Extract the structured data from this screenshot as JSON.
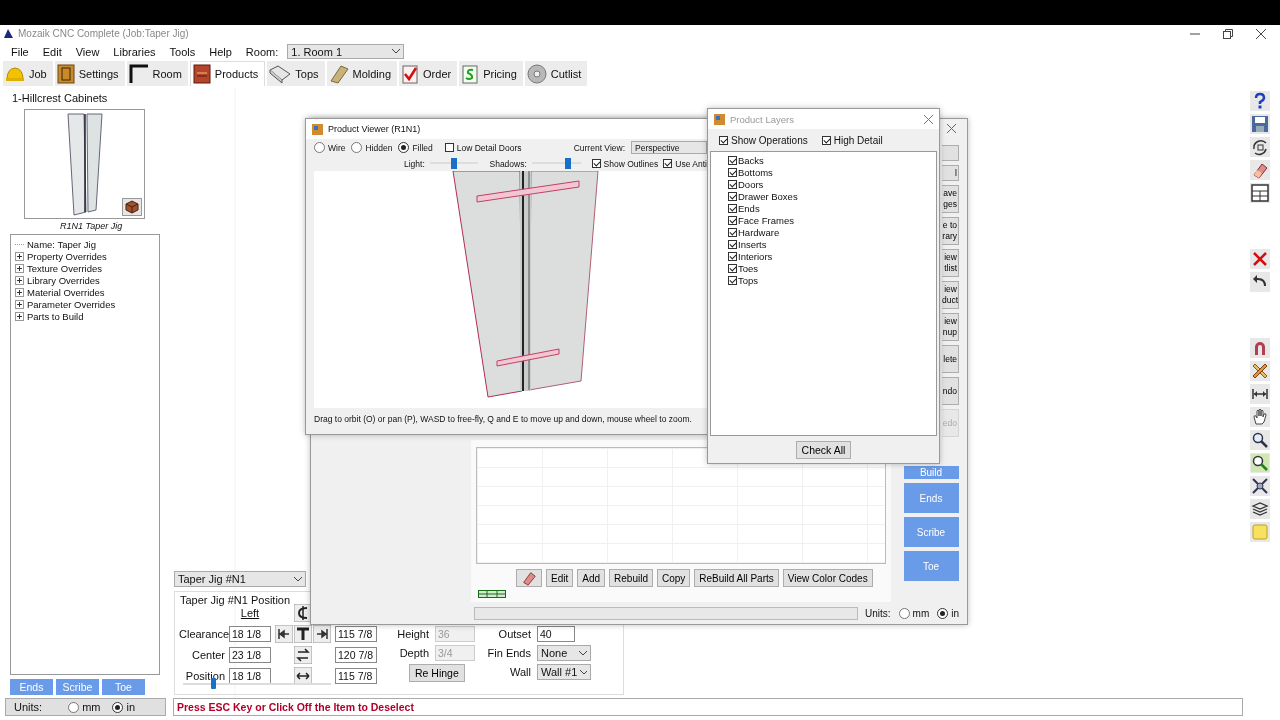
{
  "window": {
    "title": "Mozaik CNC Complete (Job:Taper Jig)"
  },
  "menu": [
    "File",
    "Edit",
    "View",
    "Libraries",
    "Tools",
    "Help"
  ],
  "room": {
    "label": "Room:",
    "value": "1. Room 1"
  },
  "tabs": [
    {
      "label": "Job",
      "selected": false
    },
    {
      "label": "Settings",
      "selected": false
    },
    {
      "label": "Room",
      "selected": false
    },
    {
      "label": "Products",
      "selected": true
    },
    {
      "label": "Tops",
      "selected": false
    },
    {
      "label": "Molding",
      "selected": false
    },
    {
      "label": "Order",
      "selected": false
    },
    {
      "label": "Pricing",
      "selected": false
    },
    {
      "label": "Cutlist",
      "selected": false
    }
  ],
  "left_panel": {
    "title": "1-Hillcrest Cabinets",
    "caption": "R1N1 Taper Jig",
    "tree": [
      {
        "label": "Name: Taper Jig"
      },
      {
        "label": "Property Overrides",
        "expanded": false
      },
      {
        "label": "Texture Overrides",
        "expanded": false
      },
      {
        "label": "Library Overrides",
        "expanded": false
      },
      {
        "label": "Material Overrides",
        "expanded": false
      },
      {
        "label": "Parameter Overrides",
        "expanded": false
      },
      {
        "label": "Parts to Build",
        "expanded": false
      }
    ],
    "buttons": [
      "Ends",
      "Scribe",
      "Toe"
    ],
    "units": {
      "label": "Units:",
      "options": [
        {
          "label": "mm",
          "selected": false
        },
        {
          "label": "in",
          "selected": true
        }
      ]
    }
  },
  "product_select": {
    "value": "Taper Jig #N1"
  },
  "position_panel": {
    "title": "Taper Jig #N1 Position",
    "column_header": "Left",
    "rows": [
      {
        "label": "Clearance",
        "left": "18 1/8",
        "right": "115 7/8"
      },
      {
        "label": "Center",
        "left": "23 1/8",
        "right": "120 7/8"
      },
      {
        "label": "Position",
        "left": "18 1/8",
        "right": "115 7/8"
      }
    ],
    "slider": {
      "level": 0.2
    },
    "middle": [
      {
        "label": "Height",
        "value": "36",
        "disabled": true
      },
      {
        "label": "Depth",
        "value": "3/4",
        "disabled": true
      }
    ],
    "rehinge": "Re Hinge",
    "right": [
      {
        "label": "Outset",
        "value": "40",
        "kind": "input"
      },
      {
        "label": "Fin Ends",
        "value": "None",
        "kind": "select"
      },
      {
        "label": "Wall",
        "value": "Wall #1",
        "kind": "select"
      }
    ]
  },
  "status_message": "Press ESC Key or Click Off the Item to Deselect",
  "editor_dialog": {
    "side_buttons": [
      {
        "kind": "short",
        "disabled": false
      },
      {
        "label": "l",
        "kind": "short",
        "disabled": false
      },
      {
        "label": "ave\nges",
        "kind": "tall",
        "disabled": false
      },
      {
        "label": "e to\nrary",
        "kind": "tall",
        "disabled": false
      },
      {
        "label": "iew\ntlist",
        "kind": "tall",
        "disabled": false
      },
      {
        "label": "iew\nduct",
        "kind": "tall",
        "disabled": false
      },
      {
        "label": "iew\nnup",
        "kind": "tall",
        "disabled": false
      },
      {
        "label": "lete",
        "kind": "tall",
        "disabled": false
      },
      {
        "label": "ndo",
        "kind": "tall",
        "disabled": false
      },
      {
        "label": "edo",
        "kind": "tall",
        "disabled": true
      },
      {
        "label": "Build",
        "kind": "blue",
        "disabled": false
      },
      {
        "label": "Ends",
        "kind": "blue",
        "disabled": false
      },
      {
        "label": "Scribe",
        "kind": "blue",
        "disabled": false
      },
      {
        "label": "Toe",
        "kind": "blue",
        "disabled": false
      }
    ],
    "progress": {
      "level": 0
    },
    "actions": [
      "Edit",
      "Add",
      "Rebuild",
      "Copy",
      "ReBuild All Parts",
      "View Color Codes"
    ],
    "units": {
      "label": "Units:",
      "options": [
        {
          "label": "mm",
          "selected": false
        },
        {
          "label": "in",
          "selected": true
        }
      ]
    }
  },
  "product_viewer": {
    "title": "Product Viewer (R1N1)",
    "render_modes": [
      {
        "label": "Wire",
        "selected": false
      },
      {
        "label": "Hidden",
        "selected": false
      },
      {
        "label": "Filled",
        "selected": true
      }
    ],
    "low_detail_doors": {
      "label": "Low Detail Doors",
      "checked": false
    },
    "current_view": {
      "label": "Current View:",
      "value": "Perspective"
    },
    "sliders": [
      {
        "label": "Light:",
        "level": 0.5
      },
      {
        "label": "Shadows:",
        "level": 0.75
      }
    ],
    "options": [
      {
        "label": "Show Outlines",
        "checked": true
      },
      {
        "label": "Use Anti",
        "checked": true
      }
    ],
    "hint": "Drag to orbit (O) or pan (P), WASD to free-fly, Q and E to move up and down, mouse wheel to zoom."
  },
  "product_layers": {
    "title": "Product Layers",
    "options": [
      {
        "label": "Show Operations",
        "checked": true
      },
      {
        "label": "High Detail",
        "checked": true
      }
    ],
    "layers": [
      {
        "label": "Backs",
        "checked": true
      },
      {
        "label": "Bottoms",
        "checked": true
      },
      {
        "label": "Doors",
        "checked": true
      },
      {
        "label": "Drawer Boxes",
        "checked": true
      },
      {
        "label": "Ends",
        "checked": true
      },
      {
        "label": "Face Frames",
        "checked": true
      },
      {
        "label": "Hardware",
        "checked": true
      },
      {
        "label": "Inserts",
        "checked": true
      },
      {
        "label": "Interiors",
        "checked": true
      },
      {
        "label": "Toes",
        "checked": true
      },
      {
        "label": "Tops",
        "checked": true
      }
    ],
    "button": "Check All"
  }
}
